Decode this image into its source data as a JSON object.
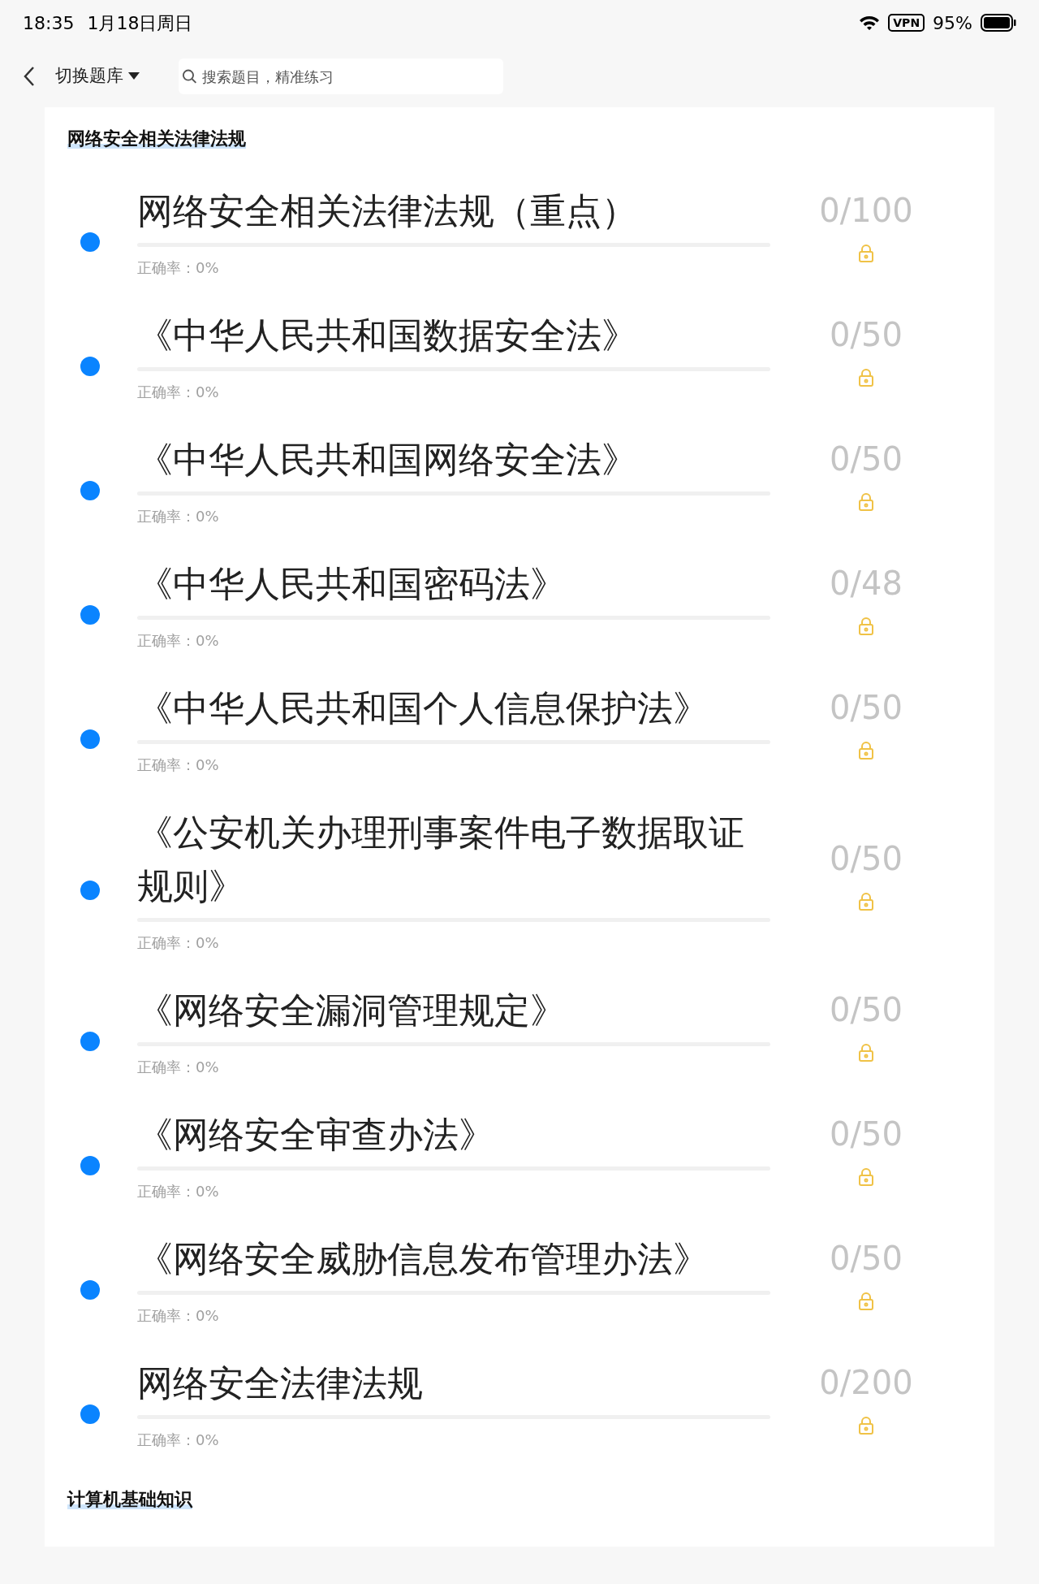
{
  "status_bar": {
    "time": "18:35",
    "date": "1月18日周日",
    "vpn": "VPN",
    "battery": "95%"
  },
  "nav": {
    "switch_label": "切换题库",
    "search": {
      "placeholder": "搜索题目，精准练习"
    }
  },
  "sections": [
    {
      "title": "网络安全相关法律法规",
      "items": [
        {
          "title": "网络安全相关法律法规（重点）",
          "count": "0/100",
          "accuracy": "正确率：0%",
          "level": 0,
          "locked": true
        },
        {
          "title": "《中华人民共和国数据安全法》",
          "count": "0/50",
          "accuracy": "正确率：0%",
          "level": 0,
          "locked": true
        },
        {
          "title": "《中华人民共和国网络安全法》",
          "count": "0/50",
          "accuracy": "正确率：0%",
          "level": 0,
          "locked": true
        },
        {
          "title": "《中华人民共和国密码法》",
          "count": "0/48",
          "accuracy": "正确率：0%",
          "level": 0,
          "locked": true
        },
        {
          "title": "《中华人民共和国个人信息保护法》",
          "count": "0/50",
          "accuracy": "正确率：0%",
          "level": 0,
          "locked": true
        },
        {
          "title": "《公安机关办理刑事案件电子数据取证规则》",
          "count": "0/50",
          "accuracy": "正确率：0%",
          "level": 0,
          "locked": true
        },
        {
          "title": "《网络安全漏洞管理规定》",
          "count": "0/50",
          "accuracy": "正确率：0%",
          "level": 0,
          "locked": true
        },
        {
          "title": "《网络安全审查办法》",
          "count": "0/50",
          "accuracy": "正确率：0%",
          "level": 0,
          "locked": true
        },
        {
          "title": "《网络安全威胁信息发布管理办法》",
          "count": "0/50",
          "accuracy": "正确率：0%",
          "level": 0,
          "locked": true
        },
        {
          "title": "网络安全法律法规",
          "count": "0/200",
          "accuracy": "正确率：0%",
          "level": 0,
          "locked": true
        }
      ]
    },
    {
      "title": "计算机基础知识"
    }
  ]
}
